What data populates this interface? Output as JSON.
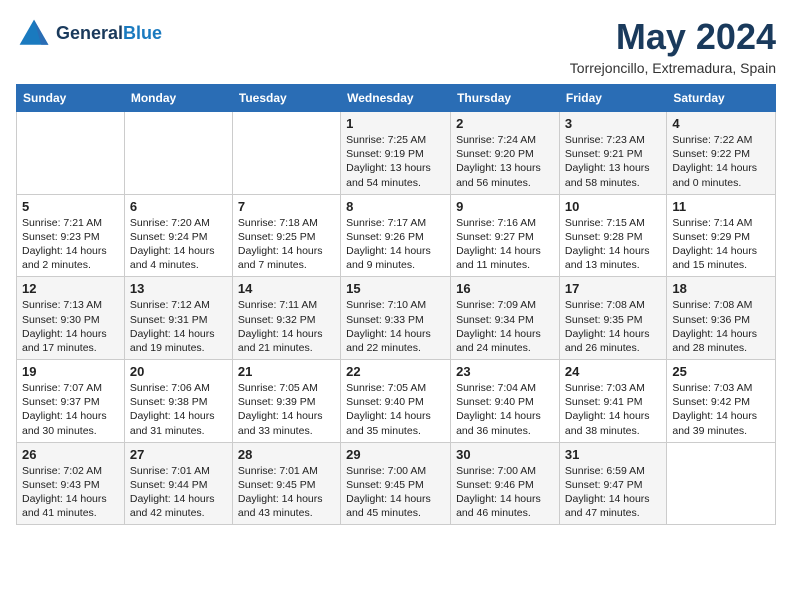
{
  "logo": {
    "line1": "General",
    "line2": "Blue"
  },
  "title": "May 2024",
  "location": "Torrejoncillo, Extremadura, Spain",
  "days_of_week": [
    "Sunday",
    "Monday",
    "Tuesday",
    "Wednesday",
    "Thursday",
    "Friday",
    "Saturday"
  ],
  "weeks": [
    [
      {
        "day": "",
        "text": ""
      },
      {
        "day": "",
        "text": ""
      },
      {
        "day": "",
        "text": ""
      },
      {
        "day": "1",
        "text": "Sunrise: 7:25 AM\nSunset: 9:19 PM\nDaylight: 13 hours and 54 minutes."
      },
      {
        "day": "2",
        "text": "Sunrise: 7:24 AM\nSunset: 9:20 PM\nDaylight: 13 hours and 56 minutes."
      },
      {
        "day": "3",
        "text": "Sunrise: 7:23 AM\nSunset: 9:21 PM\nDaylight: 13 hours and 58 minutes."
      },
      {
        "day": "4",
        "text": "Sunrise: 7:22 AM\nSunset: 9:22 PM\nDaylight: 14 hours and 0 minutes."
      }
    ],
    [
      {
        "day": "5",
        "text": "Sunrise: 7:21 AM\nSunset: 9:23 PM\nDaylight: 14 hours and 2 minutes."
      },
      {
        "day": "6",
        "text": "Sunrise: 7:20 AM\nSunset: 9:24 PM\nDaylight: 14 hours and 4 minutes."
      },
      {
        "day": "7",
        "text": "Sunrise: 7:18 AM\nSunset: 9:25 PM\nDaylight: 14 hours and 7 minutes."
      },
      {
        "day": "8",
        "text": "Sunrise: 7:17 AM\nSunset: 9:26 PM\nDaylight: 14 hours and 9 minutes."
      },
      {
        "day": "9",
        "text": "Sunrise: 7:16 AM\nSunset: 9:27 PM\nDaylight: 14 hours and 11 minutes."
      },
      {
        "day": "10",
        "text": "Sunrise: 7:15 AM\nSunset: 9:28 PM\nDaylight: 14 hours and 13 minutes."
      },
      {
        "day": "11",
        "text": "Sunrise: 7:14 AM\nSunset: 9:29 PM\nDaylight: 14 hours and 15 minutes."
      }
    ],
    [
      {
        "day": "12",
        "text": "Sunrise: 7:13 AM\nSunset: 9:30 PM\nDaylight: 14 hours and 17 minutes."
      },
      {
        "day": "13",
        "text": "Sunrise: 7:12 AM\nSunset: 9:31 PM\nDaylight: 14 hours and 19 minutes."
      },
      {
        "day": "14",
        "text": "Sunrise: 7:11 AM\nSunset: 9:32 PM\nDaylight: 14 hours and 21 minutes."
      },
      {
        "day": "15",
        "text": "Sunrise: 7:10 AM\nSunset: 9:33 PM\nDaylight: 14 hours and 22 minutes."
      },
      {
        "day": "16",
        "text": "Sunrise: 7:09 AM\nSunset: 9:34 PM\nDaylight: 14 hours and 24 minutes."
      },
      {
        "day": "17",
        "text": "Sunrise: 7:08 AM\nSunset: 9:35 PM\nDaylight: 14 hours and 26 minutes."
      },
      {
        "day": "18",
        "text": "Sunrise: 7:08 AM\nSunset: 9:36 PM\nDaylight: 14 hours and 28 minutes."
      }
    ],
    [
      {
        "day": "19",
        "text": "Sunrise: 7:07 AM\nSunset: 9:37 PM\nDaylight: 14 hours and 30 minutes."
      },
      {
        "day": "20",
        "text": "Sunrise: 7:06 AM\nSunset: 9:38 PM\nDaylight: 14 hours and 31 minutes."
      },
      {
        "day": "21",
        "text": "Sunrise: 7:05 AM\nSunset: 9:39 PM\nDaylight: 14 hours and 33 minutes."
      },
      {
        "day": "22",
        "text": "Sunrise: 7:05 AM\nSunset: 9:40 PM\nDaylight: 14 hours and 35 minutes."
      },
      {
        "day": "23",
        "text": "Sunrise: 7:04 AM\nSunset: 9:40 PM\nDaylight: 14 hours and 36 minutes."
      },
      {
        "day": "24",
        "text": "Sunrise: 7:03 AM\nSunset: 9:41 PM\nDaylight: 14 hours and 38 minutes."
      },
      {
        "day": "25",
        "text": "Sunrise: 7:03 AM\nSunset: 9:42 PM\nDaylight: 14 hours and 39 minutes."
      }
    ],
    [
      {
        "day": "26",
        "text": "Sunrise: 7:02 AM\nSunset: 9:43 PM\nDaylight: 14 hours and 41 minutes."
      },
      {
        "day": "27",
        "text": "Sunrise: 7:01 AM\nSunset: 9:44 PM\nDaylight: 14 hours and 42 minutes."
      },
      {
        "day": "28",
        "text": "Sunrise: 7:01 AM\nSunset: 9:45 PM\nDaylight: 14 hours and 43 minutes."
      },
      {
        "day": "29",
        "text": "Sunrise: 7:00 AM\nSunset: 9:45 PM\nDaylight: 14 hours and 45 minutes."
      },
      {
        "day": "30",
        "text": "Sunrise: 7:00 AM\nSunset: 9:46 PM\nDaylight: 14 hours and 46 minutes."
      },
      {
        "day": "31",
        "text": "Sunrise: 6:59 AM\nSunset: 9:47 PM\nDaylight: 14 hours and 47 minutes."
      },
      {
        "day": "",
        "text": ""
      }
    ]
  ]
}
